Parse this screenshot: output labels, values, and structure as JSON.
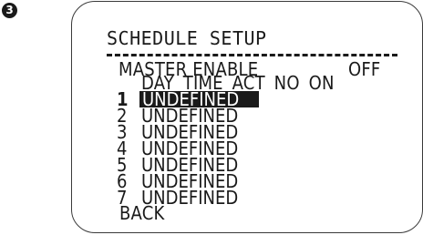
{
  "step_badge": "3",
  "screen": {
    "title": "SCHEDULE SETUP",
    "master_enable": {
      "label": "MASTER ENABLE",
      "value": "OFF"
    },
    "columns_header": "DAY TIME  ACT NO ON",
    "schedules": [
      {
        "number": "1",
        "name": "UNDEFINED",
        "selected": true
      },
      {
        "number": "2",
        "name": "UNDEFINED",
        "selected": false
      },
      {
        "number": "3",
        "name": "UNDEFINED",
        "selected": false
      },
      {
        "number": "4",
        "name": "UNDEFINED",
        "selected": false
      },
      {
        "number": "5",
        "name": "UNDEFINED",
        "selected": false
      },
      {
        "number": "6",
        "name": "UNDEFINED",
        "selected": false
      },
      {
        "number": "7",
        "name": "UNDEFINED",
        "selected": false
      }
    ],
    "back_label": "BACK"
  },
  "colors": {
    "text": "#1a1a1a",
    "highlight_background": "#1a1a1a",
    "highlight_text": "#ffffff",
    "background": "#ffffff"
  }
}
